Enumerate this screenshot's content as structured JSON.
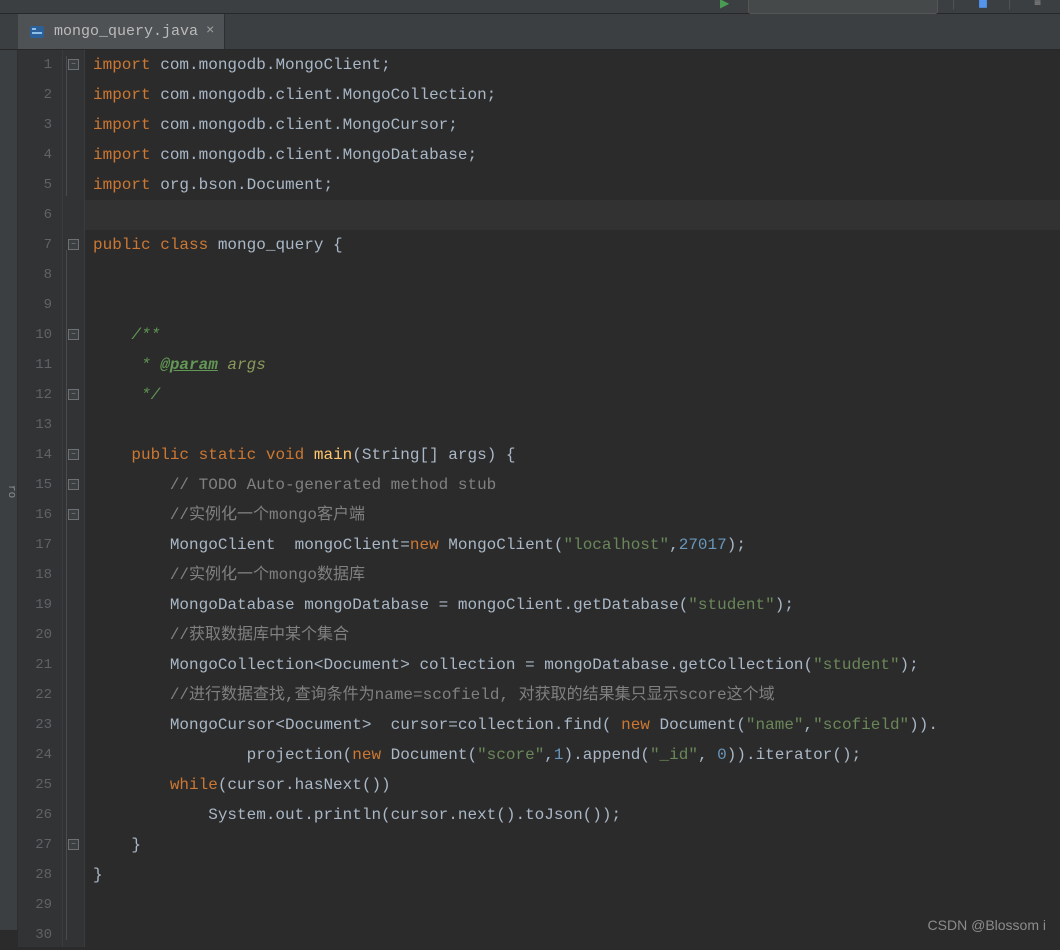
{
  "tab": {
    "filename": "mongo_query.java"
  },
  "left_margin_label": "ro",
  "watermark": "CSDN @Blossom i",
  "gutter": [
    "1",
    "2",
    "3",
    "4",
    "5",
    "6",
    "7",
    "8",
    "9",
    "10",
    "11",
    "12",
    "13",
    "14",
    "15",
    "16",
    "17",
    "18",
    "19",
    "20",
    "21",
    "22",
    "23",
    "24",
    "25",
    "26",
    "27",
    "28",
    "29",
    "30"
  ],
  "current_line_index": 5,
  "code": {
    "l1": {
      "kw": "import ",
      "pkg": "com.mongodb.MongoClient",
      "end": ";"
    },
    "l2": {
      "kw": "import ",
      "pkg": "com.mongodb.client.MongoCollection",
      "end": ";"
    },
    "l3": {
      "kw": "import ",
      "pkg": "com.mongodb.client.MongoCursor",
      "end": ";"
    },
    "l4": {
      "kw": "import ",
      "pkg": "com.mongodb.client.MongoDatabase",
      "end": ";"
    },
    "l5": {
      "kw": "import ",
      "pkg": "org.bson.Document",
      "end": ";"
    },
    "l7": {
      "kw1": "public ",
      "kw2": "class ",
      "name": "mongo_query ",
      "brace": "{"
    },
    "l10": {
      "txt": "    /**"
    },
    "l11": {
      "pre": "     * ",
      "tag": "@param",
      "arg": " args"
    },
    "l12": {
      "txt": "     */"
    },
    "l14": {
      "indent": "    ",
      "kw1": "public ",
      "kw2": "static ",
      "kw3": "void ",
      "fn": "main",
      "sig": "(String[] args) {"
    },
    "l15": {
      "indent": "        ",
      "cmt": "// TODO Auto-generated method stub"
    },
    "l16": {
      "indent": "        ",
      "gray": "//",
      "cn": "实例化一个mongo客户端"
    },
    "l17": {
      "indent": "        ",
      "a": "MongoClient  mongoClient=",
      "kw": "new ",
      "b": "MongoClient(",
      "s": "\"localhost\"",
      "c": ",",
      "n": "27017",
      "d": ");"
    },
    "l18": {
      "indent": "        ",
      "gray": "//",
      "cn": "实例化一个mongo数据库"
    },
    "l19": {
      "indent": "        ",
      "a": "MongoDatabase mongoDatabase = mongoClient.getDatabase(",
      "s": "\"student\"",
      "b": ");"
    },
    "l20": {
      "indent": "        ",
      "gray": "//",
      "cn": "获取数据库中某个集合"
    },
    "l21": {
      "indent": "        ",
      "a": "MongoCollection<Document> collection = mongoDatabase.getCollection(",
      "s": "\"student\"",
      "b": ");"
    },
    "l22": {
      "indent": "        ",
      "gray": "//",
      "cn": "进行数据查找,查询条件为name=scofield, 对获取的结果集只显示score这个域"
    },
    "l23": {
      "indent": "        ",
      "a": "MongoCursor<Document>  cursor=collection.find( ",
      "kw": "new ",
      "b": "Document(",
      "s1": "\"name\"",
      "c": ",",
      "s2": "\"scofield\"",
      "d": "))."
    },
    "l24": {
      "indent": "                ",
      "a": "projection(",
      "kw": "new ",
      "b": "Document(",
      "s1": "\"score\"",
      "c1": ",",
      "n1": "1",
      "c2": ").append(",
      "s2": "\"_id\"",
      "c3": ", ",
      "n2": "0",
      "d": ")).iterator();"
    },
    "l25": {
      "indent": "        ",
      "kw": "while",
      "a": "(cursor.hasNext())"
    },
    "l26": {
      "indent": "            ",
      "a": "System.out.println(cursor.next().toJson());"
    },
    "l27": {
      "indent": "    ",
      "brace": "}"
    },
    "l28": {
      "brace": "}"
    }
  }
}
